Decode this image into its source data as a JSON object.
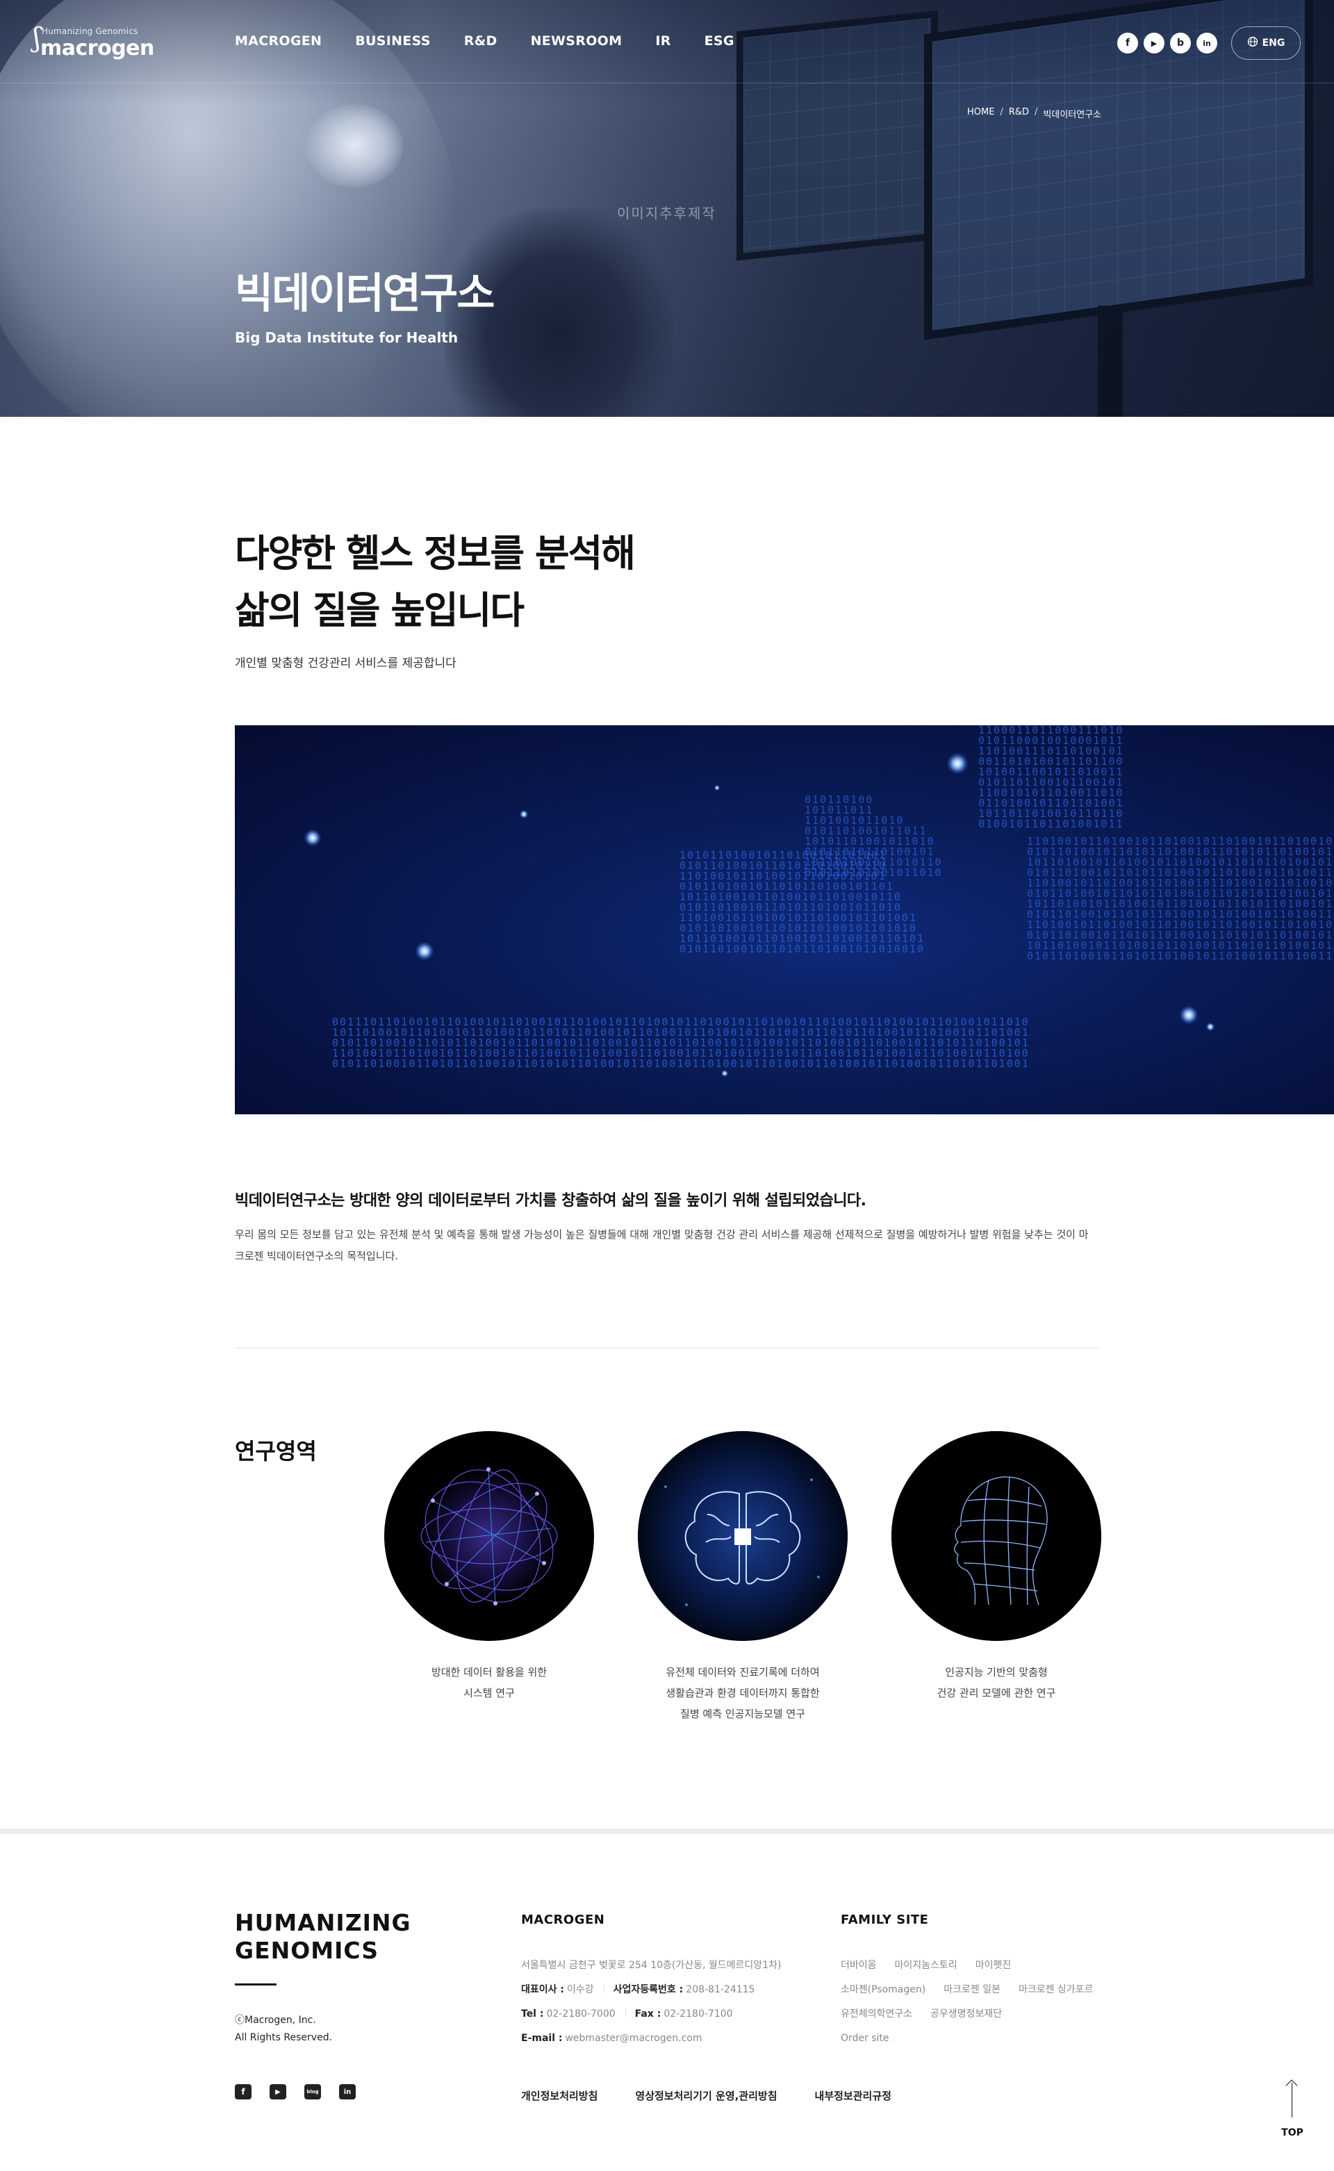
{
  "header": {
    "logo_small": "Humanizing Genomics",
    "logo_main": "macrogen",
    "nav": [
      "MACROGEN",
      "BUSINESS",
      "R&D",
      "NEWSROOM",
      "IR",
      "ESG"
    ],
    "sns": [
      {
        "icon": "facebook-icon",
        "glyph": "f"
      },
      {
        "icon": "youtube-icon",
        "glyph": "▶"
      },
      {
        "icon": "blog-icon",
        "glyph": "b"
      },
      {
        "icon": "linkedin-icon",
        "glyph": "in"
      }
    ],
    "lang_label": "ENG"
  },
  "hero": {
    "breadcrumb": [
      "HOME",
      "R&D",
      "빅데이터연구소"
    ],
    "watermark": "이미지추후제작",
    "title": "빅데이터연구소",
    "subtitle": "Big Data Institute for Health"
  },
  "intro": {
    "title_line1": "다양한 헬스 정보를 분석해",
    "title_line2": "삶의 질을 높입니다",
    "subtitle": "개인별 맞춤형 건강관리 서비스를 제공합니다",
    "lead": "빅데이터연구소는 방대한 양의 데이터로부터 가치를 창출하여 삶의 질을 높이기 위해 설립되었습니다.",
    "description": "우리 몸의 모든 정보를 담고 있는 유전체 분석 및 예측을 통해 발생 가능성이 높은 질병들에 대해 개인별 맞춤형 건강 관리 서비스를 제공해 선제적으로 질병을 예방하거나 발병 위험을 낮추는 것이 마크로젠 빅데이터연구소의 목적입니다."
  },
  "research": {
    "title": "연구영역",
    "items": [
      {
        "icon": "globe-network-icon",
        "caption_lines": [
          "방대한 데이터 활용을 위한",
          "시스템 연구"
        ]
      },
      {
        "icon": "brain-chip-icon",
        "caption_lines": [
          "유전체 데이터와 진료기록에 더하여",
          "생활습관과 환경 데이터까지 통합한",
          "질병 예측 인공지능모델 연구"
        ]
      },
      {
        "icon": "wireframe-head-icon",
        "caption_lines": [
          "인공지능 기반의 맞춤형",
          "건강 관리 모델에 관한 연구"
        ]
      }
    ]
  },
  "footer": {
    "brand_line1": "HUMANIZING",
    "brand_line2": "GENOMICS",
    "copyright_line1": "ⓒMacrogen, Inc.",
    "copyright_line2": "All Rights Reserved.",
    "company_heading": "MACROGEN",
    "address": "서울특별시 금천구 벚꽃로 254 10층(가산동, 월드메르디앙1차)",
    "ceo_label": "대표이사 :",
    "ceo": "이수강",
    "bizno_label": "사업자등록번호 :",
    "bizno": "208-81-24115",
    "tel_label": "Tel :",
    "tel": "02-2180-7000",
    "fax_label": "Fax :",
    "fax": "02-2180-7100",
    "email_label": "E-mail :",
    "email": "webmaster@macrogen.com",
    "family_heading": "FAMILY SITE",
    "family_rows": [
      [
        "더바이옴",
        "마이지놈스토리",
        "마이펫진"
      ],
      [
        "소마젠(Psomagen)",
        "마크로젠 일본",
        "마크로젠 싱가포르"
      ],
      [
        "유전체의학연구소",
        "공우생명정보재단"
      ],
      [
        "Order site"
      ]
    ],
    "sns": [
      {
        "icon": "facebook-icon",
        "glyph": "f"
      },
      {
        "icon": "youtube-icon",
        "glyph": "▶"
      },
      {
        "icon": "blog-icon",
        "glyph": "blog"
      },
      {
        "icon": "linkedin-icon",
        "glyph": "in"
      }
    ],
    "policy_links": [
      "개인정보처리방침",
      "영상정보처리기기 운영,관리방침",
      "내부정보관리규정"
    ],
    "top_label": "TOP"
  }
}
